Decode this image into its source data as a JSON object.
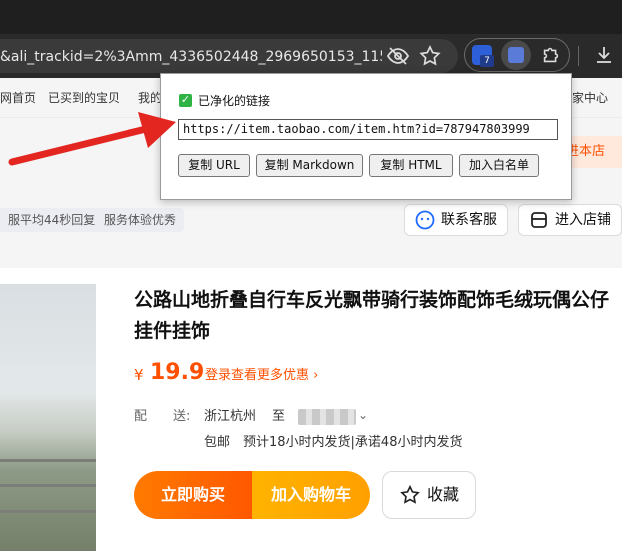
{
  "browser": {
    "url": "&ali_trackid=2%3Amm_4336502448_2969650153_115...",
    "extension_badge": "7"
  },
  "nav": {
    "items": [
      "网首页",
      "已买到的宝贝",
      "我的",
      "家中心"
    ]
  },
  "shop": {
    "enter_store_partial": "进本店"
  },
  "service_tags": [
    "服平均44秒回复",
    "服务体验优秀"
  ],
  "actions": {
    "contact_service": "联系客服",
    "enter_shop": "进入店铺"
  },
  "product": {
    "title": "公路山地折叠自行车反光飘带骑行装饰配饰毛绒玩偶公仔挂件挂饰",
    "currency": "¥",
    "price": "19.9",
    "promo_link": "登录查看更多优惠 ›",
    "shipping_label": "配　　送:",
    "shipping_from": "浙江杭州",
    "shipping_to_label": "至",
    "shipping_info": "包邮　预计18小时内发货|承诺48小时内发货",
    "buy_now": "立即购买",
    "add_to_cart": "加入购物车",
    "favorite": "收藏"
  },
  "popup": {
    "checkbox_label": "已净化的链接",
    "checked": true,
    "clean_url": "https://item.taobao.com/item.htm?id=787947803999",
    "buttons": [
      "复制 URL",
      "复制 Markdown",
      "复制 HTML",
      "加入白名单"
    ]
  },
  "colors": {
    "accent": "#ff5000",
    "annotation_arrow": "#e32620",
    "checkbox": "#2fb344"
  }
}
